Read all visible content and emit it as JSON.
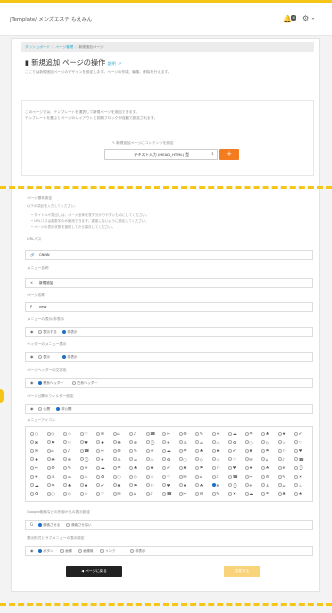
{
  "header": {
    "brand": "jTemplate/ メンズエステ もえみん",
    "notification_count": "4",
    "bell_icon": "bell-icon",
    "gear_icon": "gear-icon",
    "caret": "▾"
  },
  "breadcrumb": {
    "items": [
      "ダッシュボード",
      "ページ管理",
      "新規追加ページ"
    ]
  },
  "page": {
    "title": "新規追加 ページの操作",
    "help_label": "説明",
    "description": "ここでは新規追加ページのデザインを設定します。ページの作成、編集、削除を行えます。"
  },
  "template_section": {
    "line1": "このページでは、テンプレートを選択して新規ページを追加できます。",
    "line2": "テンプレートを選ぶとページのレイアウトと初期ブロックが自動で設定されます。",
    "select_label": "新規追加ページにコンテンツを設定",
    "select_value": "テキスト入力 (HEAD_HTML) 型",
    "add_label": "+"
  },
  "form": {
    "intro_label": "ページ基本設定",
    "intro_hint": "以下の項目を入力してください。",
    "bullets": [
      "• タイトルや見出しは、ページ全体を表す分かりやすいものにしてください。",
      "• URLパスは英数字のみ使用できます。重複しないように設定してください。",
      "• ページの表示状態を選択してから保存してください。"
    ],
    "url_label": "URLパス",
    "url_value": "CNNN",
    "name_label": "メニュー名称",
    "name_value": "新規追加",
    "title_label": "ページ名称",
    "title_value": "new",
    "r1": {
      "label": "メニューの表示/非表示",
      "a": "表示する",
      "b": "非表示"
    },
    "r2": {
      "label": "ヘッダーのメニュー表示",
      "a": "表示",
      "b": "非表示"
    },
    "r3": {
      "label": "ページヘッダーの文字色",
      "a": "黒系ヘッダー",
      "b": "白系ヘッダー"
    },
    "r4": {
      "label": "ページ公開のフィルター設定",
      "a": "公開",
      "b": "非公開"
    },
    "icon_label": "メニューアイコン",
    "search_label": "Google検索などの外部からの表示設定",
    "search_a": "検索させる",
    "search_b": "検索させない",
    "bottom_label": "表示形式とサブメニューの表示設定",
    "bottom_opts": [
      "ボタン",
      "画像",
      "画像無",
      "リンク",
      "非表示"
    ]
  },
  "icons": [
    "○",
    "◇",
    "☆",
    "♡",
    "✉",
    "⌂",
    "♪",
    "☎",
    "✂",
    "⚙",
    "✎",
    "☀",
    "☁",
    "☂",
    "♣",
    "♠",
    "✔",
    "✖",
    "⚑",
    "⚐",
    "♥",
    "♦",
    "☘",
    "❄",
    "⌚",
    "✈",
    "⚓",
    "☕",
    "♨",
    "♻"
  ],
  "buttons": {
    "back": "◀ ページに戻る",
    "save": "変更する"
  },
  "colors": {
    "accent": "#f5c518",
    "primary": "#f47c20",
    "link": "#2aa7c9",
    "radio_on": "#1d6fc6"
  }
}
